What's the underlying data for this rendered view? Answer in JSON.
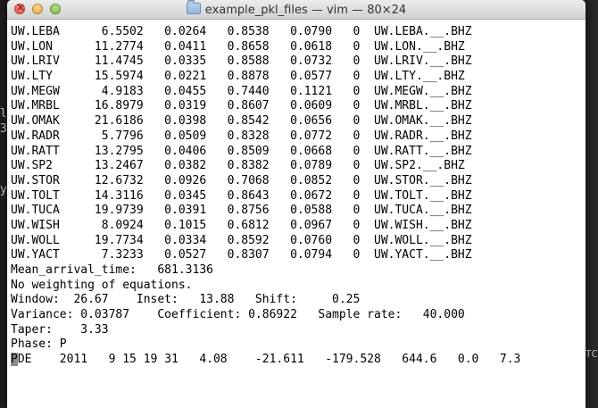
{
  "window": {
    "title": "example_pkl_files — vim — 80×24"
  },
  "terminal": {
    "station_rows": [
      "UW.LEBA      6.5502   0.0264   0.8538   0.0790   0  UW.LEBA.__.BHZ",
      "UW.LON      11.2774   0.0411   0.8658   0.0618   0  UW.LON.__.BHZ",
      "UW.LRIV     11.4745   0.0335   0.8588   0.0732   0  UW.LRIV.__.BHZ",
      "UW.LTY      15.5974   0.0221   0.8878   0.0577   0  UW.LTY.__.BHZ",
      "UW.MEGW      4.9183   0.0455   0.7440   0.1121   0  UW.MEGW.__.BHZ",
      "UW.MRBL     16.8979   0.0319   0.8607   0.0609   0  UW.MRBL.__.BHZ",
      "UW.OMAK     21.6186   0.0398   0.8542   0.0656   0  UW.OMAK.__.BHZ",
      "UW.RADR      5.7796   0.0509   0.8328   0.0772   0  UW.RADR.__.BHZ",
      "UW.RATT     13.2795   0.0406   0.8509   0.0668   0  UW.RATT.__.BHZ",
      "UW.SP2      13.2467   0.0382   0.8382   0.0789   0  UW.SP2.__.BHZ",
      "UW.STOR     12.6732   0.0926   0.7068   0.0852   0  UW.STOR.__.BHZ",
      "UW.TOLT     14.3116   0.0345   0.8643   0.0672   0  UW.TOLT.__.BHZ",
      "UW.TUCA     19.9739   0.0391   0.8756   0.0588   0  UW.TUCA.__.BHZ",
      "UW.WISH      8.0924   0.1015   0.6812   0.0967   0  UW.WISH.__.BHZ",
      "UW.WOLL     19.7734   0.0334   0.8592   0.0760   0  UW.WOLL.__.BHZ",
      "UW.YACT      7.3233   0.0527   0.8307   0.0794   0  UW.YACT.__.BHZ"
    ],
    "mean_arrival": "Mean_arrival_time:   681.3136",
    "weighting": "No weighting of equations.",
    "window_line": "Window:  26.67    Inset:   13.88   Shift:     0.25",
    "variance_line": "Variance: 0.03787    Coefficient: 0.86922   Sample rate:   40.000",
    "taper_line": "Taper:    3.33",
    "phase_line": "Phase: P",
    "pde_cursor_char": "P",
    "pde_rest": "DE    2011   9 15 19 31   4.08    -21.611   -179.528   644.6   0.0   7.3"
  },
  "background": {
    "left_fragments": [
      "ll",
      "3",
      "y"
    ],
    "right_fragment": "TC"
  }
}
